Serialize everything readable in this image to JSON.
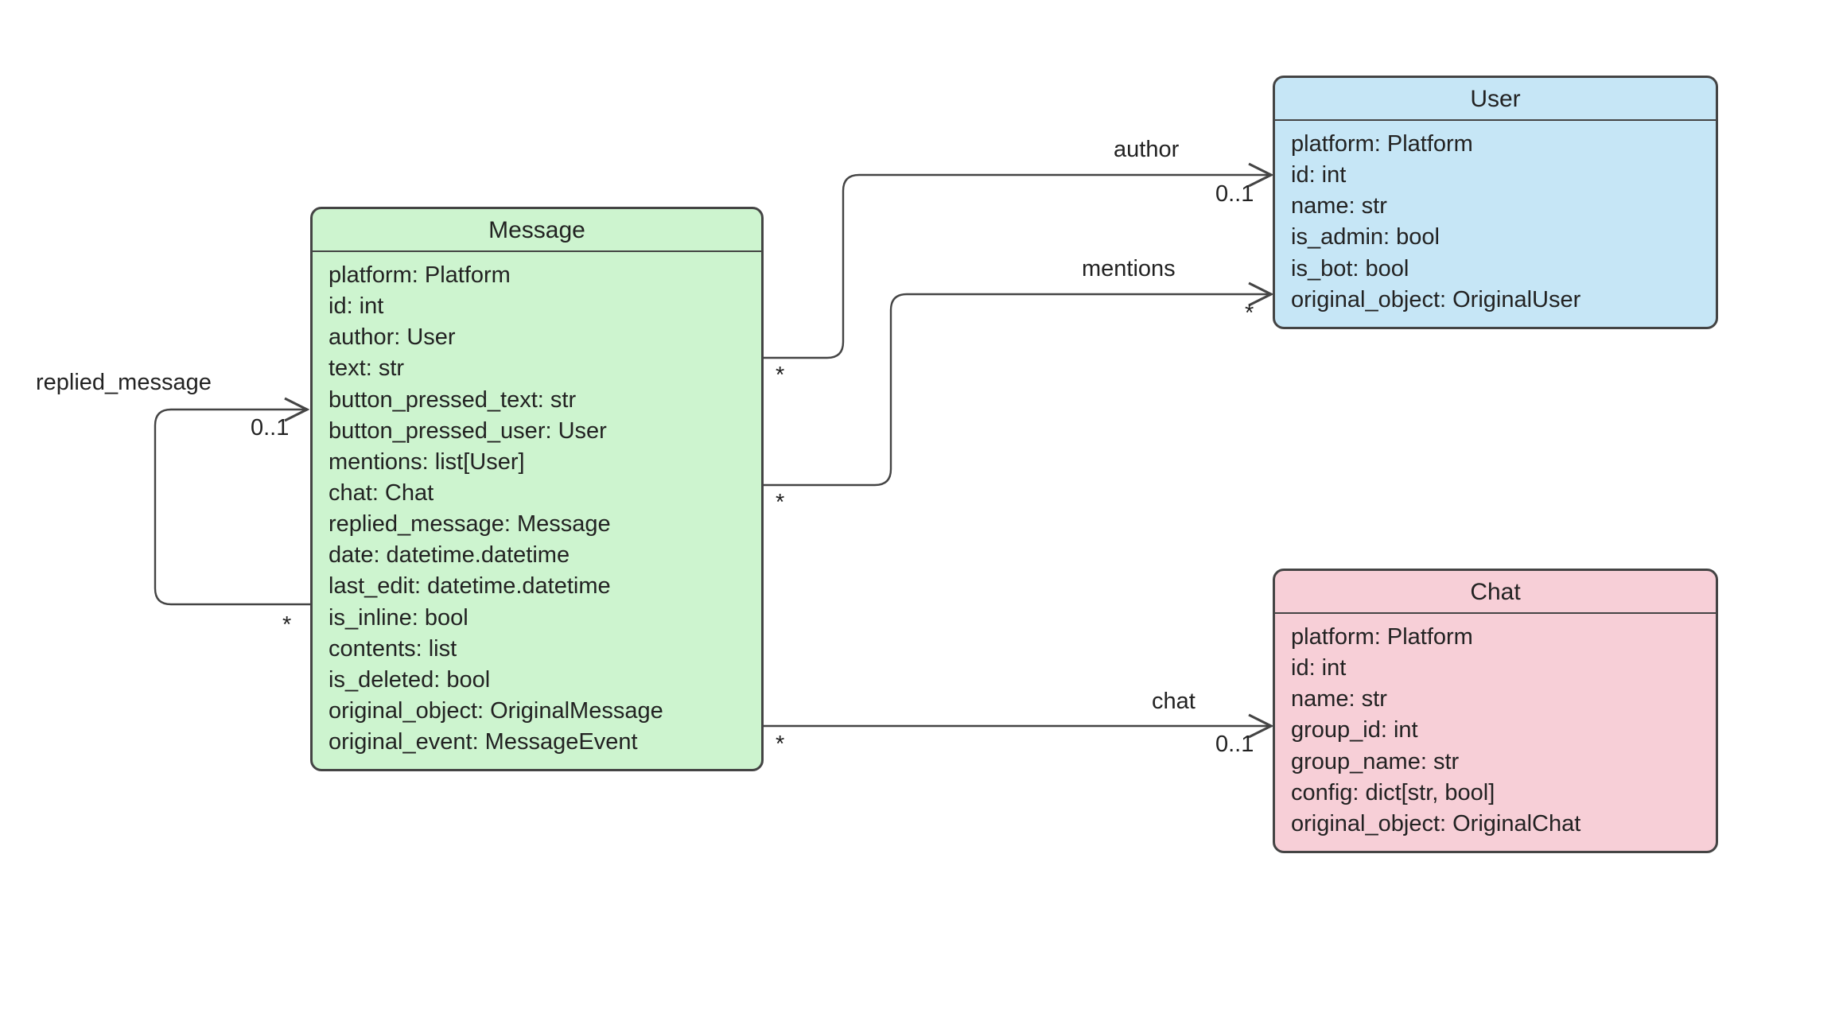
{
  "colors": {
    "message_bg": "#cdf4cf",
    "user_bg": "#c6e6f6",
    "chat_bg": "#f7cfd7",
    "border": "#444444"
  },
  "classes": {
    "message": {
      "title": "Message",
      "attrs": [
        "platform: Platform",
        "id: int",
        "author: User",
        "text: str",
        "button_pressed_text: str",
        "button_pressed_user: User",
        "mentions: list[User]",
        "chat: Chat",
        "replied_message: Message",
        "date: datetime.datetime",
        "last_edit: datetime.datetime",
        "is_inline: bool",
        "contents: list",
        "is_deleted: bool",
        "original_object: OriginalMessage",
        "original_event: MessageEvent"
      ]
    },
    "user": {
      "title": "User",
      "attrs": [
        "platform: Platform",
        "id: int",
        "name: str",
        "is_admin: bool",
        "is_bot: bool",
        "original_object: OriginalUser"
      ]
    },
    "chat": {
      "title": "Chat",
      "attrs": [
        "platform: Platform",
        "id: int",
        "name: str",
        "group_id: int",
        "group_name: str",
        "config: dict[str, bool]",
        "original_object: OriginalChat"
      ]
    }
  },
  "relations": {
    "author": {
      "name": "author",
      "src_mult": "*",
      "dst_mult": "0..1"
    },
    "mentions": {
      "name": "mentions",
      "src_mult": "*",
      "dst_mult": "*"
    },
    "chat": {
      "name": "chat",
      "src_mult": "*",
      "dst_mult": "0..1"
    },
    "replied": {
      "name": "replied_message",
      "src_mult": "*",
      "dst_mult": "0..1"
    }
  }
}
